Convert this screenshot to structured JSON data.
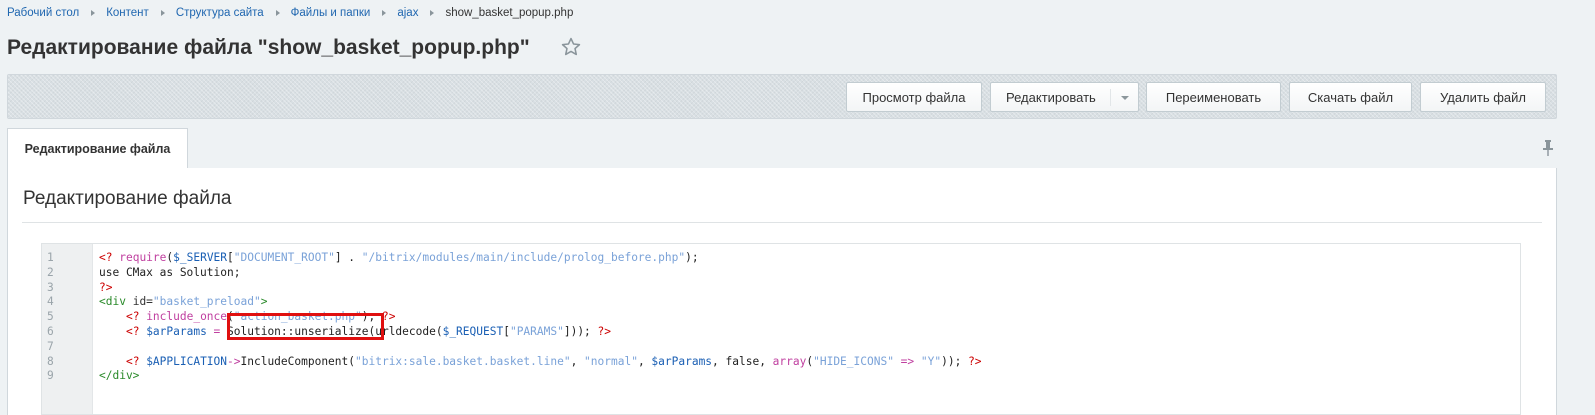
{
  "breadcrumb": [
    "Рабочий стол",
    "Контент",
    "Структура сайта",
    "Файлы и папки",
    "ajax"
  ],
  "breadcrumb_current": "show_basket_popup.php",
  "page_title": "Редактирование файла \"show_basket_popup.php\"",
  "toolbar": {
    "view": "Просмотр файла",
    "edit": "Редактировать",
    "rename": "Переименовать",
    "download": "Скачать файл",
    "delete": "Удалить файл"
  },
  "tab_label": "Редактирование файла",
  "section_title": "Редактирование файла",
  "code": {
    "line_numbers": [
      "1",
      "2",
      "3",
      "4",
      "5",
      "6",
      "7",
      "8",
      "9"
    ],
    "l1": {
      "open": "<?",
      "fn": "require",
      "p1": "(",
      "var": "$_SERVER",
      "p2": "[",
      "key": "\"DOCUMENT_ROOT\"",
      "p3": "] . ",
      "path": "\"/bitrix/modules/main/include/prolog_before.php\"",
      "end": ");"
    },
    "l2": "use CMax as Solution;",
    "l3": "?>",
    "l4": {
      "tag_open": "<div",
      "attr": "id=",
      "val": "\"basket_preload\"",
      "close": ">"
    },
    "l5": {
      "indent": "    ",
      "open": "<?",
      "fn": "include_once",
      "p1": "(",
      "str": "\"action_basket.php\"",
      "p2": "); ",
      "close": "?>"
    },
    "l6": {
      "indent": "    ",
      "open": "<?",
      "var": "$arParams",
      "eq": " = ",
      "call": "Solution::unserialize",
      "rest1": "(urldecode(",
      "var2": "$_REQUEST",
      "p1": "[",
      "key": "\"PARAMS\"",
      "p2": "])); ",
      "close": "?>"
    },
    "l8": {
      "indent": "    ",
      "open": "<?",
      "var": "$APPLICATION",
      "arrow": "->",
      "method": "IncludeComponent(",
      "s1": "\"bitrix:sale.basket.basket.line\"",
      "c1": ", ",
      "s2": "\"normal\"",
      "c2": ", ",
      "var2": "$arParams",
      "c3": ", false, ",
      "arr": "array",
      "p1": "(",
      "s3": "\"HIDE_ICONS\"",
      "arrow2": " => ",
      "s4": "\"Y\"",
      "p2": ")); ",
      "close": "?>"
    },
    "l9": "</div>"
  },
  "colors": {
    "link": "#2067b0",
    "php_tag": "#cc0000",
    "string": "#7aa2d8",
    "variable": "#1a5fb4",
    "highlight_border": "#e01010"
  },
  "icons": [
    "star-icon",
    "chevron-right-icon",
    "chevron-down-icon",
    "pin-icon"
  ]
}
